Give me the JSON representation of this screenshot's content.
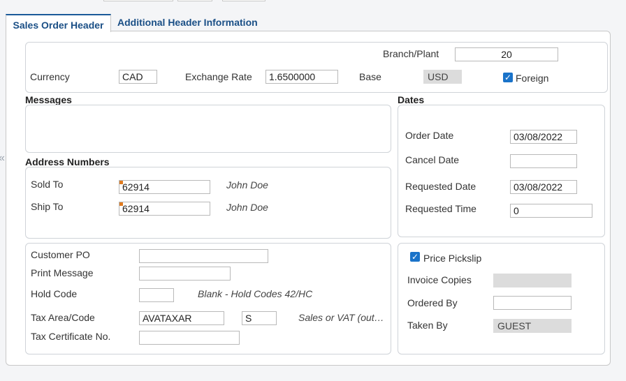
{
  "tabs": [
    {
      "label": "Sales Order Header"
    },
    {
      "label": "Additional Header Information"
    }
  ],
  "top_section": {
    "branch_plant": {
      "label": "Branch/Plant",
      "value": "20"
    },
    "currency": {
      "label": "Currency",
      "value": "CAD"
    },
    "exchange_rate": {
      "label": "Exchange Rate",
      "value": "1.6500000"
    },
    "base": {
      "label": "Base",
      "value": "USD"
    },
    "foreign": {
      "label": "Foreign",
      "checked": true
    }
  },
  "messages": {
    "title": "Messages"
  },
  "dates": {
    "title": "Dates",
    "order_date": {
      "label": "Order Date",
      "value": "03/08/2022"
    },
    "cancel_date": {
      "label": "Cancel Date",
      "value": ""
    },
    "requested_date": {
      "label": "Requested Date",
      "value": "03/08/2022"
    },
    "requested_time": {
      "label": "Requested Time",
      "value": "0"
    }
  },
  "address_numbers": {
    "title": "Address Numbers",
    "sold_to": {
      "label": "Sold To",
      "value": "62914",
      "name": "John Doe"
    },
    "ship_to": {
      "label": "Ship To",
      "value": "62914",
      "name": "John Doe"
    }
  },
  "order_info": {
    "customer_po": {
      "label": "Customer PO",
      "value": ""
    },
    "print_message": {
      "label": "Print Message",
      "value": ""
    },
    "hold_code": {
      "label": "Hold Code",
      "value": "",
      "hint": "Blank - Hold Codes 42/HC"
    },
    "tax_area": {
      "label": "Tax Area/Code",
      "value": "AVATAXAR",
      "code": "S",
      "hint": "Sales or VAT (out…"
    },
    "tax_certificate": {
      "label": "Tax Certificate No.",
      "value": ""
    }
  },
  "pickslip": {
    "price_pickslip": {
      "label": "Price Pickslip",
      "checked": true
    },
    "invoice_copies": {
      "label": "Invoice Copies",
      "value": ""
    },
    "ordered_by": {
      "label": "Ordered By",
      "value": ""
    },
    "taken_by": {
      "label": "Taken By",
      "value": "GUEST"
    }
  },
  "icons": {
    "check": "✓",
    "collapse": "«"
  },
  "colors": {
    "accent": "#1a5a99",
    "checkbox": "#1a73c9",
    "required_marker": "#e07b1f"
  }
}
